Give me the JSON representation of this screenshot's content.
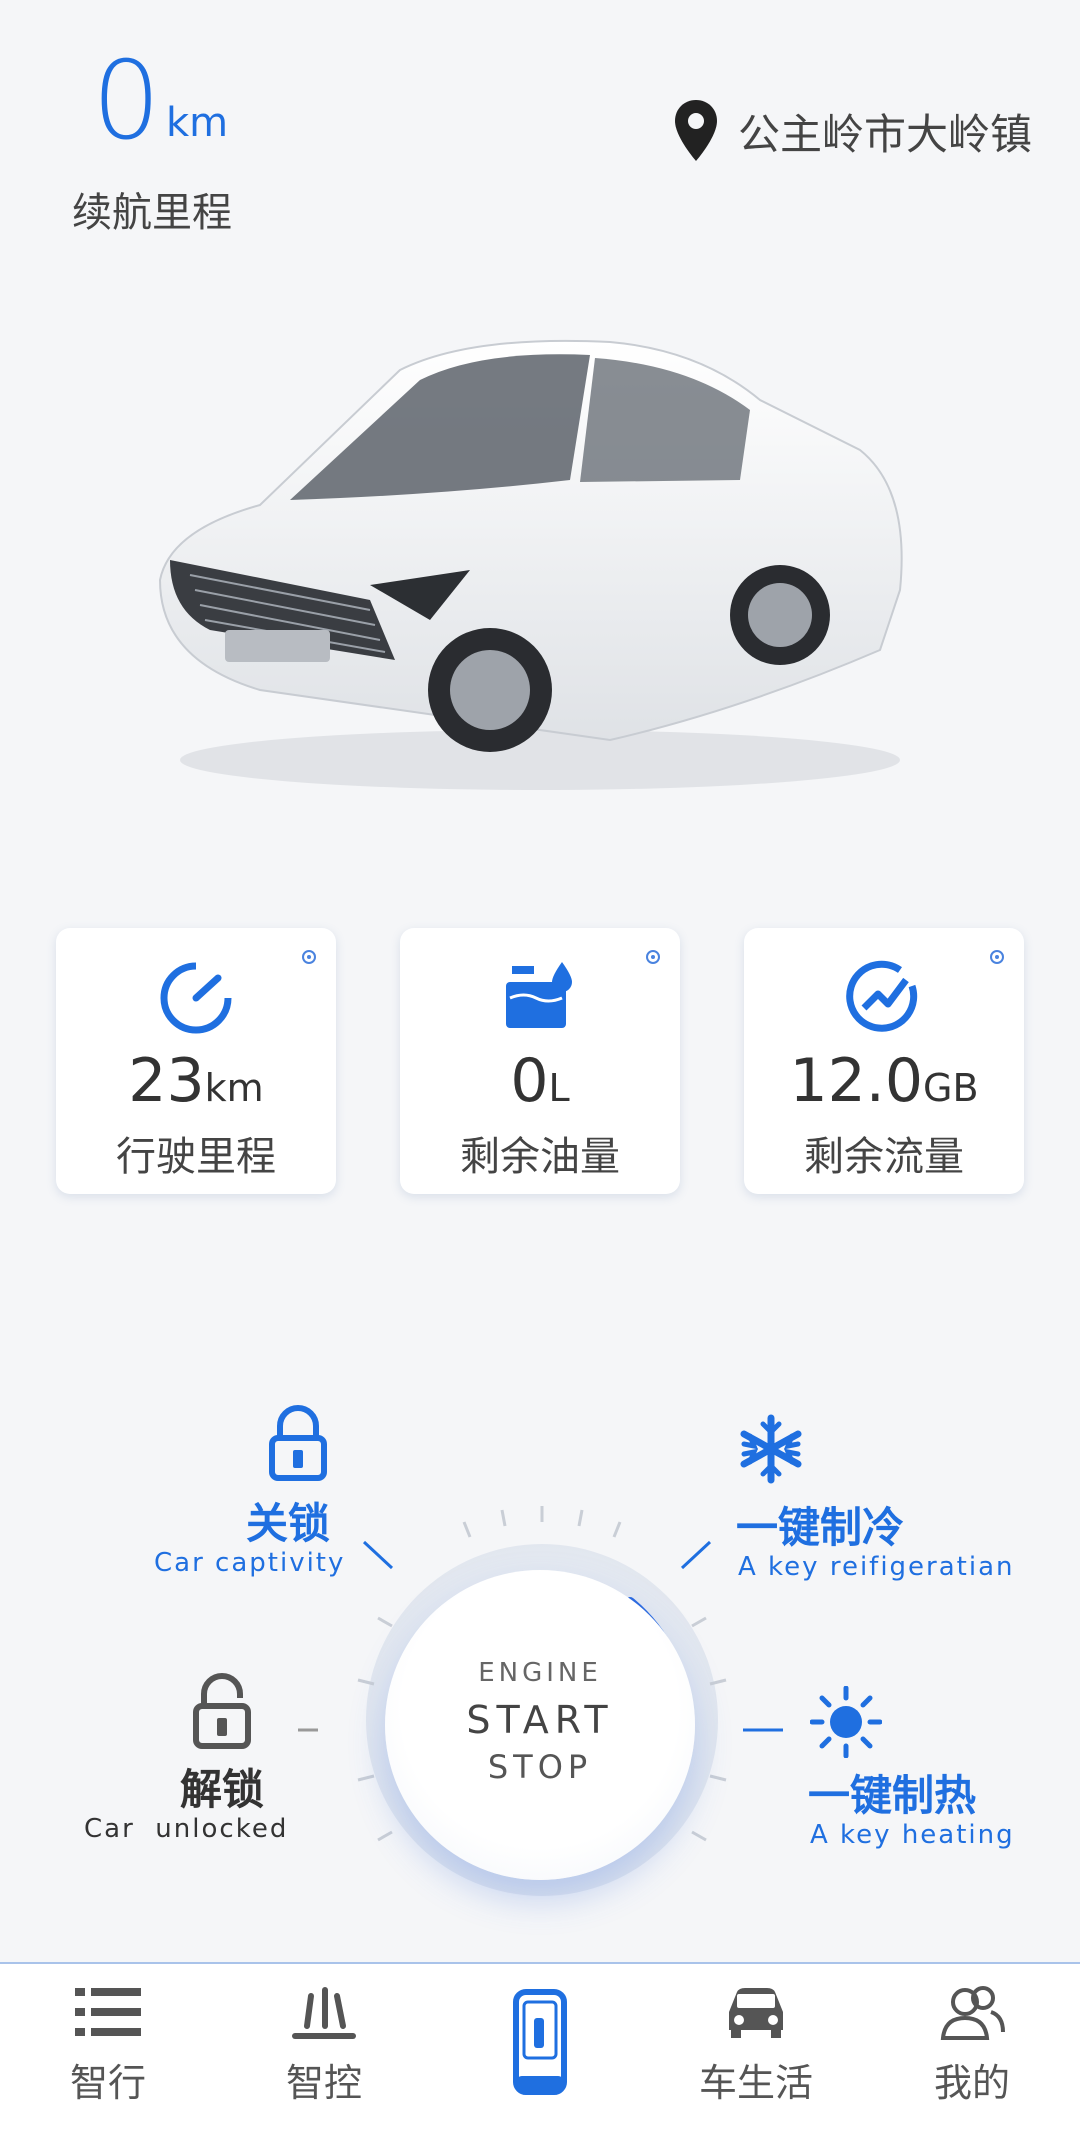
{
  "header": {
    "range_value": "0",
    "range_unit": "km",
    "range_label": "续航里程",
    "location": "公主岭市大岭镇"
  },
  "stats": [
    {
      "icon": "speedometer-icon",
      "value": "23",
      "unit": "km",
      "label": "行驶里程"
    },
    {
      "icon": "fuel-tank-icon",
      "value": "0",
      "unit": "L",
      "label": "剩余油量"
    },
    {
      "icon": "data-traffic-icon",
      "value": "12.0",
      "unit": "GB",
      "label": "剩余流量"
    }
  ],
  "engine": {
    "top": "ENGINE",
    "start": "START",
    "stop": "STOP"
  },
  "controls": {
    "lock": {
      "cn": "关锁",
      "en": "Car captivity"
    },
    "unlock": {
      "cn": "解锁",
      "en": "Car  unlocked"
    },
    "cool": {
      "cn": "一键制冷",
      "en": "A key reifigeratian"
    },
    "heat": {
      "cn": "一键制热",
      "en": "A key heating"
    }
  },
  "nav": [
    {
      "label": "智行",
      "icon": "list-icon"
    },
    {
      "label": "智控",
      "icon": "control-icon"
    },
    {
      "label": "",
      "icon": "car-key-icon"
    },
    {
      "label": "车生活",
      "icon": "car-icon"
    },
    {
      "label": "我的",
      "icon": "users-icon"
    }
  ],
  "colors": {
    "accent": "#1f6fe0",
    "background": "#f5f6f8"
  }
}
